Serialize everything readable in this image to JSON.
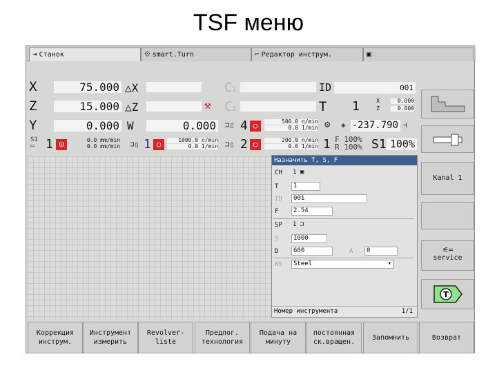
{
  "slide_title": "TSF меню",
  "tabs": [
    {
      "label": "Станок"
    },
    {
      "label": "smart.Turn"
    },
    {
      "label": "Редактор инструм."
    },
    {
      "label": ""
    }
  ],
  "axes": {
    "x": {
      "label": "X",
      "value": "75.000",
      "delta": "△X"
    },
    "z": {
      "label": "Z",
      "value": "15.000",
      "delta": "△Z"
    },
    "y": {
      "label": "Y",
      "value": "0.000",
      "extra": "W",
      "extra_value": "0.000"
    }
  },
  "c_axes": {
    "c1": "C",
    "c1_sub": "1",
    "c2": "C",
    "c2_sub": "2"
  },
  "tool": {
    "id_label": "ID",
    "id_value": "001",
    "t_label": "T",
    "t_value": "1",
    "x_label": "X",
    "x_val": "0.000",
    "z_label": "Z",
    "z_val": "0.000"
  },
  "spindles": {
    "s4": {
      "num": "4",
      "rpm": "500.0 n/min",
      "rpm2": "0.0 1/min"
    },
    "s2": {
      "num": "2",
      "rpm": "200.0 n/min",
      "rpm2": "0.0 1/min"
    },
    "s1a": {
      "num": "1",
      "feed": "0.0 mm/min",
      "feed2": "0.0 mm/min"
    },
    "s1b": {
      "num": "1",
      "rpm": "1000.0 n/min",
      "rpm2": "0.0 1/min"
    },
    "slot": "S1",
    "angle": "-237.790",
    "f_label": "F",
    "f_value": "100%",
    "r_label": "R",
    "r_value": "100%",
    "s1_label": "S1",
    "s1_value": "100%",
    "tool_num": "1",
    "s1_badge": "S1"
  },
  "dialog": {
    "title": "Назначить T, S, F",
    "ch_label": "CH",
    "ch_value": "1",
    "t_label": "T",
    "t_value": "1",
    "id_label": "ID",
    "id_value": "001",
    "f_label": "F",
    "f_value": "2.54",
    "sp_label": "SP",
    "sp_value": "1",
    "s_label": "S",
    "s_value": "1000",
    "d_label": "D",
    "d_value": "600",
    "a_label": "A",
    "a_value": "0",
    "ws_label": "WS",
    "ws_value": "Steel",
    "status": "Номер инструмента",
    "page": "1/1"
  },
  "vsoftkeys": {
    "kanal": "Kanal 1",
    "service": "service"
  },
  "hsoftkeys": [
    "Коррекция\nинструм.",
    "Инструмент\nизмерить",
    "Revolver-\nliste",
    "Предлог.\nтехнология",
    "Подача на\nминуту",
    "постоянная\nск.вращен.",
    "Запомнить",
    "Возврат"
  ],
  "colors": {
    "accent": "#3c5f8e",
    "alarm_red": "#d9242a",
    "panel": "#d7d8d6"
  }
}
